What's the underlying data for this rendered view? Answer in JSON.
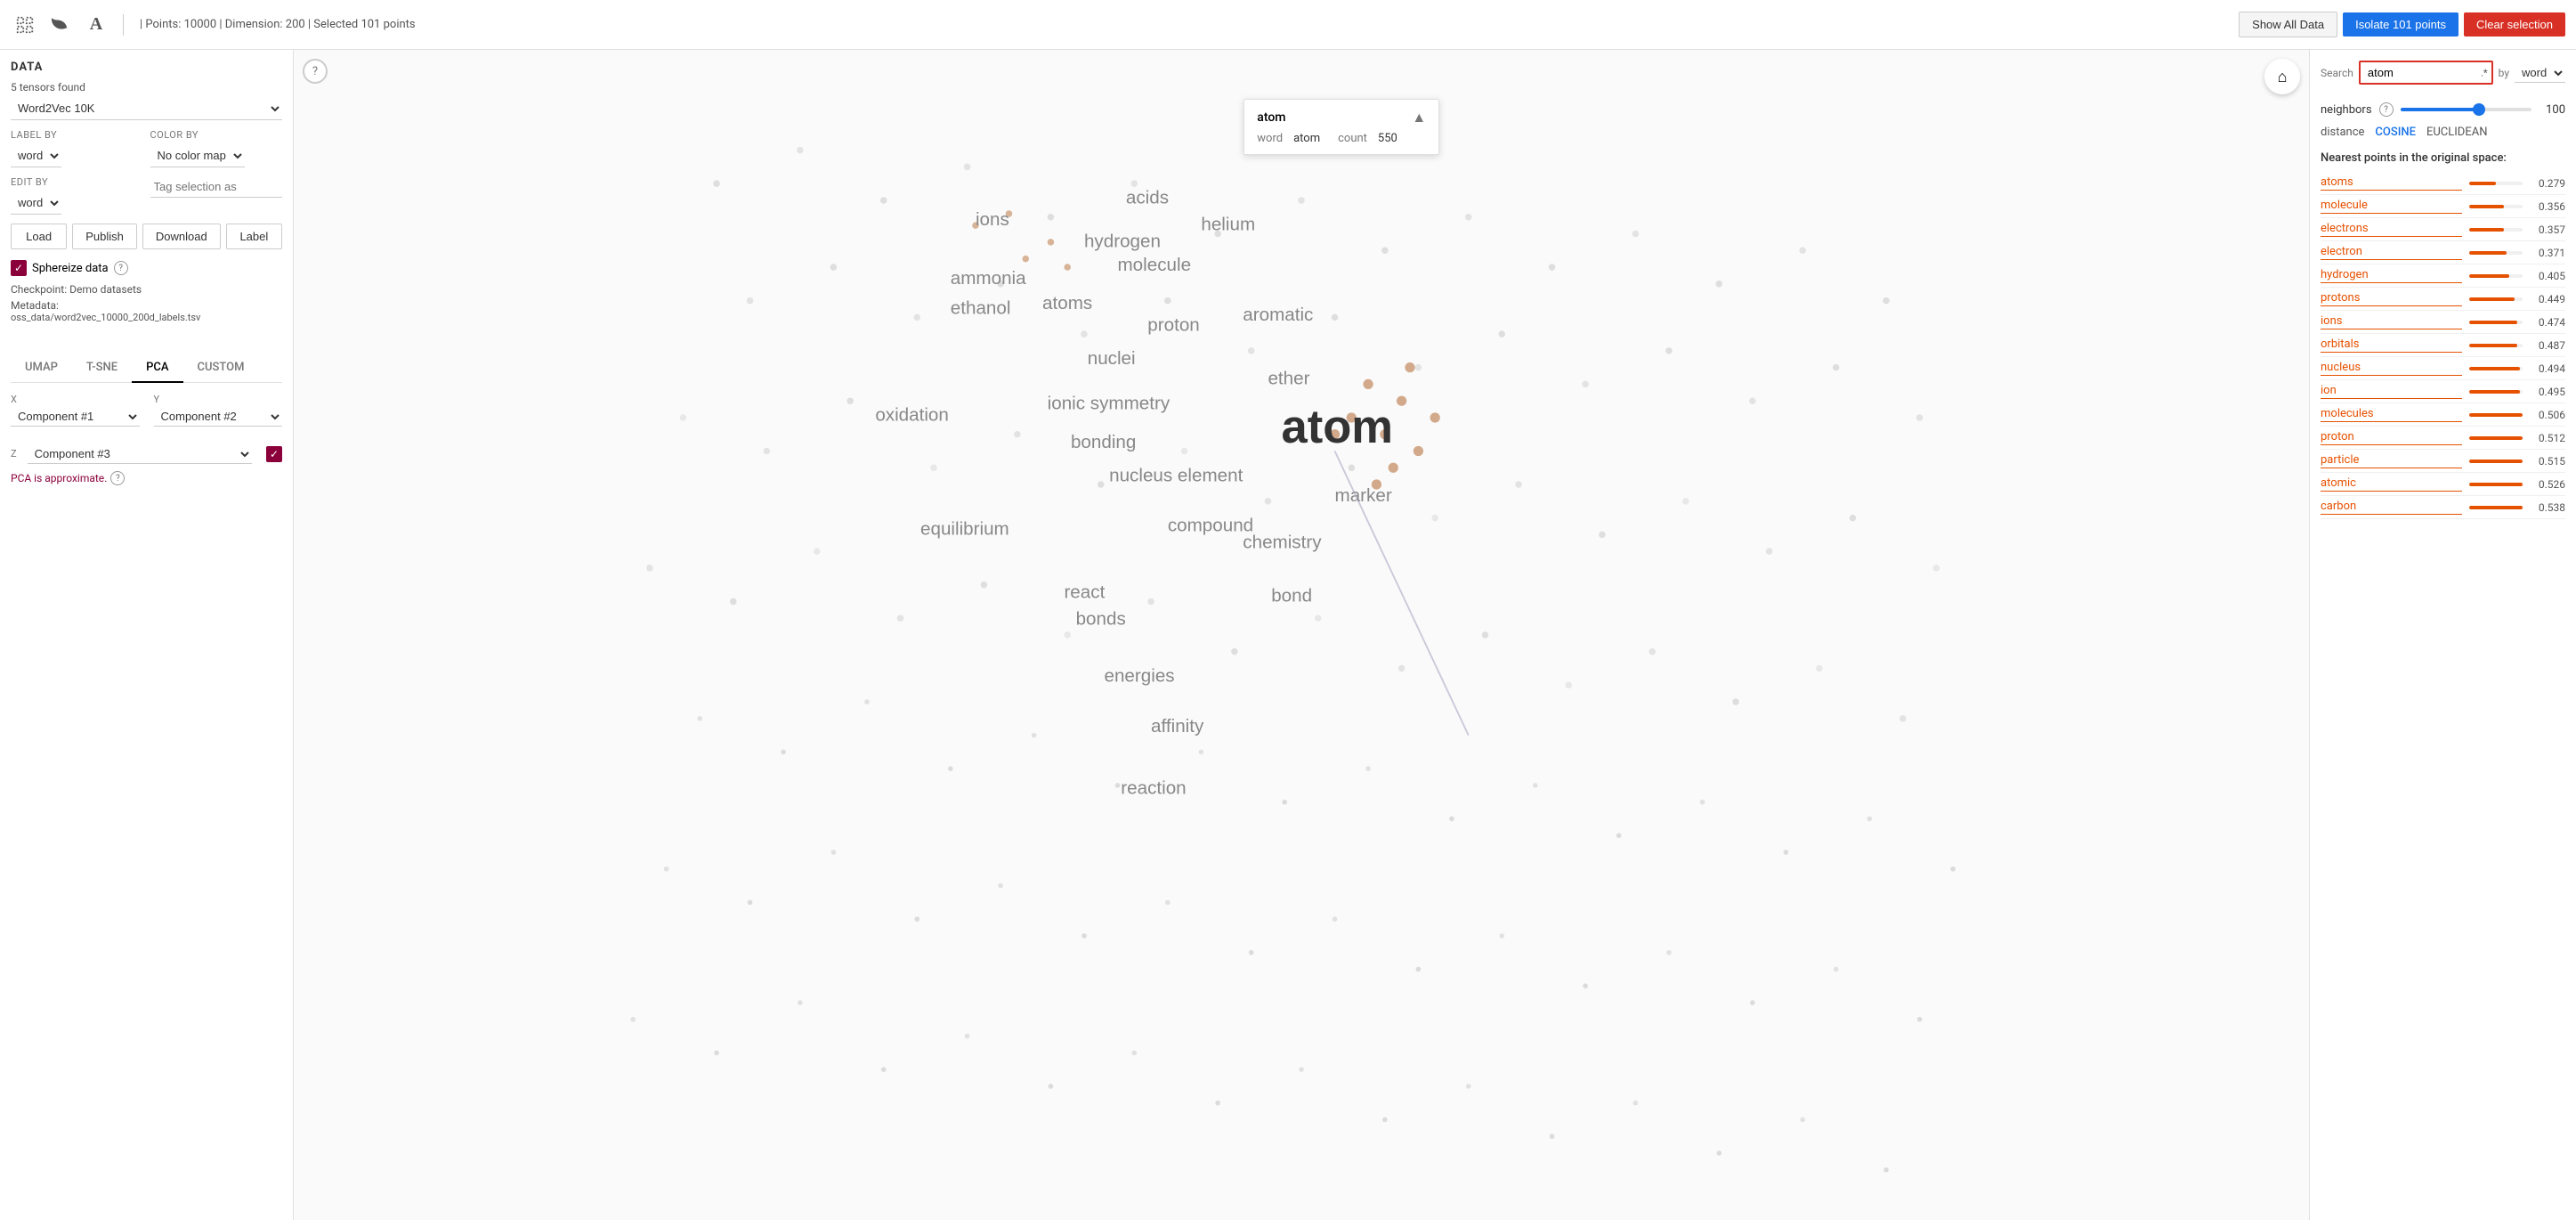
{
  "topbar": {
    "points_info": "| Points: 10000 | Dimension: 200 | Selected 101 points",
    "show_all_label": "Show All Data",
    "isolate_label": "Isolate 101 points",
    "clear_label": "Clear selection"
  },
  "sidebar": {
    "title": "DATA",
    "tensors_found": "5 tensors found",
    "dataset": "Word2Vec 10K",
    "label_by_label": "Label by",
    "label_by_value": "word",
    "color_by_label": "Color by",
    "color_by_value": "No color map",
    "edit_by_label": "Edit by",
    "edit_by_value": "word",
    "tag_placeholder": "Tag selection as",
    "load_label": "Load",
    "publish_label": "Publish",
    "download_label": "Download",
    "label_btn_label": "Label",
    "sphereize_label": "Sphereize data",
    "checkpoint_label": "Checkpoint:",
    "checkpoint_value": "Demo datasets",
    "metadata_label": "Metadata:",
    "metadata_value": "oss_data/word2vec_10000_200d_labels.tsv"
  },
  "projection_tabs": [
    "UMAP",
    "T-SNE",
    "PCA",
    "CUSTOM"
  ],
  "active_tab": "PCA",
  "pca": {
    "x_label": "X",
    "x_value": "Component #1",
    "y_label": "Y",
    "y_value": "Component #2",
    "z_label": "Z",
    "z_value": "Component #3",
    "note": "PCA is approximate."
  },
  "search_panel": {
    "search_label": "Search",
    "search_value": "atom",
    "search_placeholder": "atom",
    "by_label": "by",
    "by_value": "word",
    "atom_card": {
      "title": "atom",
      "word_label": "word",
      "word_value": "atom",
      "count_label": "count",
      "count_value": "550"
    },
    "neighbors_label": "neighbors",
    "neighbors_value": "100",
    "distance_label": "distance",
    "cosine_label": "COSINE",
    "euclidean_label": "EUCLIDEAN",
    "nearest_title": "Nearest points in the original space:",
    "nearest_points": [
      {
        "word": "atoms",
        "score": "0.279",
        "bar": 10
      },
      {
        "word": "molecule",
        "score": "0.356",
        "bar": 13
      },
      {
        "word": "electrons",
        "score": "0.357",
        "bar": 13
      },
      {
        "word": "electron",
        "score": "0.371",
        "bar": 14
      },
      {
        "word": "hydrogen",
        "score": "0.405",
        "bar": 15
      },
      {
        "word": "protons",
        "score": "0.449",
        "bar": 17
      },
      {
        "word": "ions",
        "score": "0.474",
        "bar": 18
      },
      {
        "word": "orbitals",
        "score": "0.487",
        "bar": 18
      },
      {
        "word": "nucleus",
        "score": "0.494",
        "bar": 19
      },
      {
        "word": "ion",
        "score": "0.495",
        "bar": 19
      },
      {
        "word": "molecules",
        "score": "0.506",
        "bar": 20
      },
      {
        "word": "proton",
        "score": "0.512",
        "bar": 20
      },
      {
        "word": "particle",
        "score": "0.515",
        "bar": 20
      },
      {
        "word": "atomic",
        "score": "0.526",
        "bar": 21
      },
      {
        "word": "carbon",
        "score": "0.538",
        "bar": 21
      }
    ]
  },
  "scatter": {
    "main_label": "atom",
    "labels": [
      {
        "text": "ions",
        "x": 28,
        "y": 14
      },
      {
        "text": "acids",
        "x": 38,
        "y": 11
      },
      {
        "text": "hydrogen",
        "x": 36,
        "y": 16
      },
      {
        "text": "helium",
        "x": 44,
        "y": 15
      },
      {
        "text": "ammonia",
        "x": 27,
        "y": 19
      },
      {
        "text": "ethanol",
        "x": 27,
        "y": 22
      },
      {
        "text": "molecule",
        "x": 38,
        "y": 18
      },
      {
        "text": "atoms",
        "x": 33,
        "y": 22
      },
      {
        "text": "proton",
        "x": 40,
        "y": 23
      },
      {
        "text": "aromatic",
        "x": 46,
        "y": 23
      },
      {
        "text": "nuclei",
        "x": 36,
        "y": 26
      },
      {
        "text": "ionic symmetry",
        "x": 33,
        "y": 30
      },
      {
        "text": "bonding",
        "x": 35,
        "y": 33
      },
      {
        "text": "nucleus element",
        "x": 37,
        "y": 36
      },
      {
        "text": "ether",
        "x": 48,
        "y": 28
      },
      {
        "text": "oxidation",
        "x": 22,
        "y": 31
      },
      {
        "text": "equilibrium",
        "x": 25,
        "y": 40
      },
      {
        "text": "compound",
        "x": 41,
        "y": 40
      },
      {
        "text": "chemistry",
        "x": 46,
        "y": 41
      },
      {
        "text": "react",
        "x": 34,
        "y": 45
      },
      {
        "text": "bonds",
        "x": 35,
        "y": 47
      },
      {
        "text": "bond",
        "x": 48,
        "y": 45
      },
      {
        "text": "energies",
        "x": 37,
        "y": 51
      },
      {
        "text": "affinity",
        "x": 40,
        "y": 55
      },
      {
        "text": "reaction",
        "x": 38,
        "y": 60
      },
      {
        "text": "marker",
        "x": 52,
        "y": 37
      }
    ]
  }
}
